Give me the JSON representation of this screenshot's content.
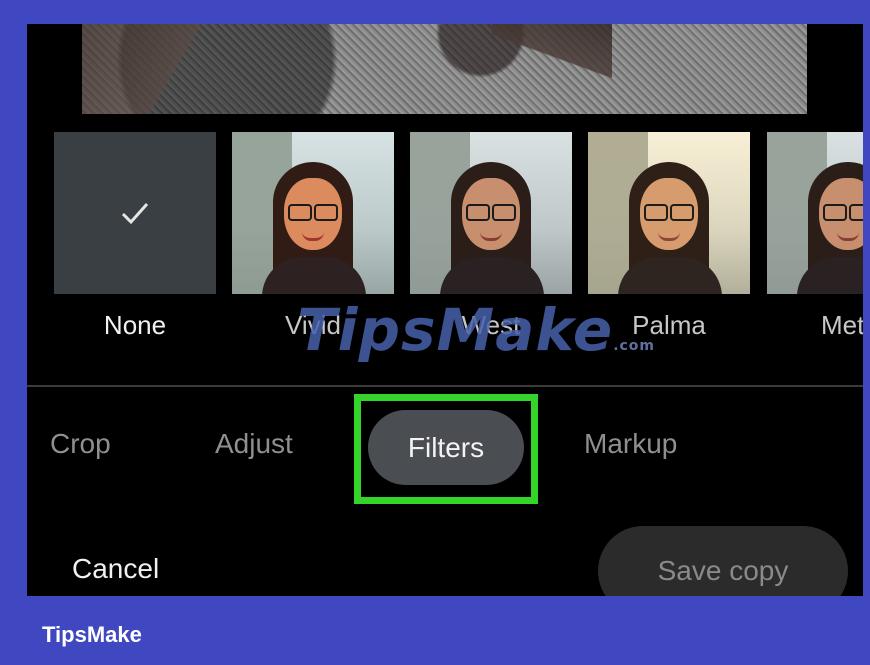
{
  "filters": {
    "items": [
      {
        "label": "None",
        "selected": true
      },
      {
        "label": "Vivid"
      },
      {
        "label": "West"
      },
      {
        "label": "Palma"
      },
      {
        "label": "Met"
      }
    ]
  },
  "tabs": {
    "crop": "Crop",
    "adjust": "Adjust",
    "filters": "Filters",
    "markup": "Markup"
  },
  "actions": {
    "cancel": "Cancel",
    "save_copy": "Save copy"
  },
  "watermark": {
    "text": "TipsMake",
    "suffix": ".com"
  },
  "footer": {
    "brand": "TipsMake"
  },
  "colors": {
    "frame": "#3f48c0",
    "highlight": "#35d42b"
  }
}
